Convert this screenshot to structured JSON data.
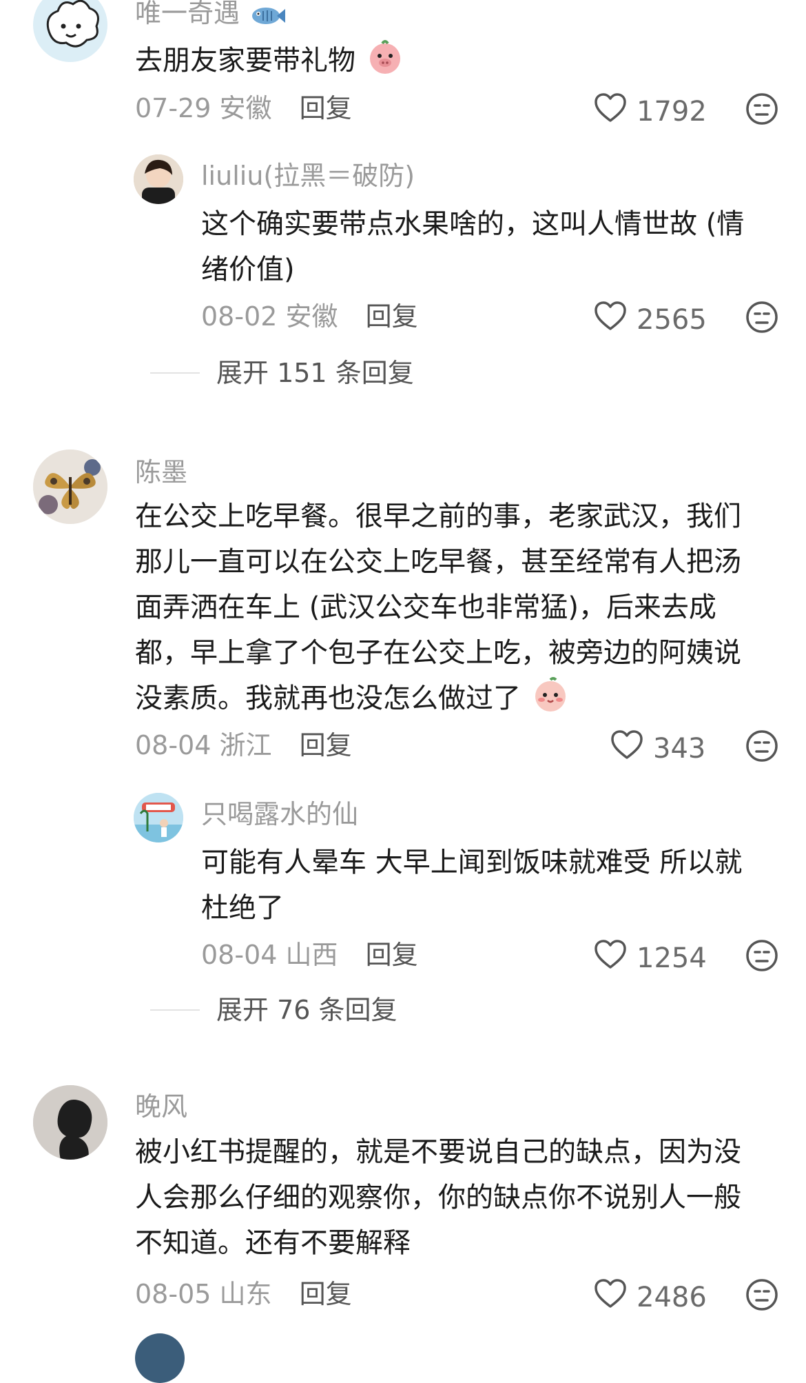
{
  "comments": [
    {
      "username": "唯一奇遇",
      "text": "去朋友家要带礼物",
      "date": "07-29",
      "region": "安徽",
      "reply_label": "回复",
      "likes": "1792",
      "icons": [
        "fish-emoji",
        "pig-emoji"
      ],
      "replies": [
        {
          "username": "liuliu(拉黑＝破防)",
          "text_line1": "这个确实要带点水果啥的，这叫人情世故 (情",
          "text_line2": "绪价值)",
          "date": "08-02",
          "region": "安徽",
          "reply_label": "回复",
          "likes": "2565"
        }
      ],
      "expand_label": "展开 151 条回复"
    },
    {
      "username": "陈墨",
      "lines": [
        "在公交上吃早餐。很早之前的事，老家武汉，我们",
        "那儿一直可以在公交上吃早餐，甚至经常有人把汤",
        "面弄洒在车上 (武汉公交车也非常猛)，后来去成",
        "都，早上拿了个包子在公交上吃，被旁边的阿姨说",
        "没素质。我就再也没怎么做过了"
      ],
      "date": "08-04",
      "region": "浙江",
      "reply_label": "回复",
      "likes": "343",
      "icons": [
        "blush-emoji"
      ],
      "replies": [
        {
          "username": "只喝露水的仙",
          "text_line1": "可能有人晕车 大早上闻到饭味就难受 所以就",
          "text_line2": "杜绝了",
          "date": "08-04",
          "region": "山西",
          "reply_label": "回复",
          "likes": "1254"
        }
      ],
      "expand_label": "展开 76 条回复"
    },
    {
      "username": "晚风",
      "lines": [
        "被小红书提醒的，就是不要说自己的缺点，因为没",
        "人会那么仔细的观察你，你的缺点你不说别人一般",
        "不知道。还有不要解释"
      ],
      "date": "08-05",
      "region": "山东",
      "reply_label": "回复",
      "likes": "2486",
      "icons": []
    }
  ],
  "icon_names": [
    "heart-icon",
    "expressionless-emoji-icon"
  ]
}
